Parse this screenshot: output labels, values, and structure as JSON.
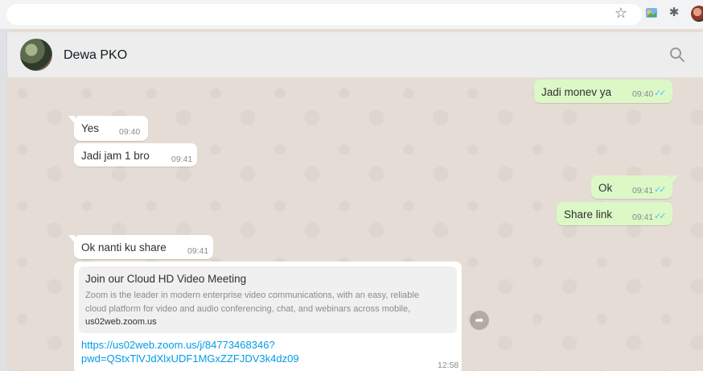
{
  "contact": {
    "name": "Dewa PKO"
  },
  "messages": [
    {
      "direction": "out",
      "text": "Jadi monev ya",
      "time": "09:40",
      "ticks": "✓✓"
    },
    {
      "direction": "in",
      "text": "Yes",
      "time": "09:40"
    },
    {
      "direction": "in",
      "text": "Jadi jam 1 bro",
      "time": "09:41"
    },
    {
      "direction": "out",
      "text": "Ok",
      "time": "09:41",
      "ticks": "✓✓"
    },
    {
      "direction": "out",
      "text": "Share link",
      "time": "09:41",
      "ticks": "✓✓"
    },
    {
      "direction": "in",
      "text": "Ok nanti ku share",
      "time": "09:41"
    }
  ],
  "link_message": {
    "preview_title": "Join our Cloud HD Video Meeting",
    "preview_description": "Zoom is the leader in modern enterprise video communications, with an easy, reliable cloud platform for video and audio conferencing, chat, and webinars across mobile,",
    "preview_domain": "us02web.zoom.us",
    "link_line1": "https://us02web.zoom.us/j/84773468346?",
    "link_line2": "pwd=QStxTlVJdXlxUDF1MGxZZFJDV3k4dz09",
    "time": "12:58"
  },
  "icons": {
    "browser_star": "star-icon",
    "extensions": [
      "extension-icon",
      "puzzle-icon"
    ],
    "search": "search-icon",
    "forward": "forward-icon"
  },
  "colors": {
    "incoming_bubble": "#ffffff",
    "outgoing_bubble": "#dcf8c6",
    "read_ticks": "#4fc3f7",
    "link": "#039be5"
  }
}
